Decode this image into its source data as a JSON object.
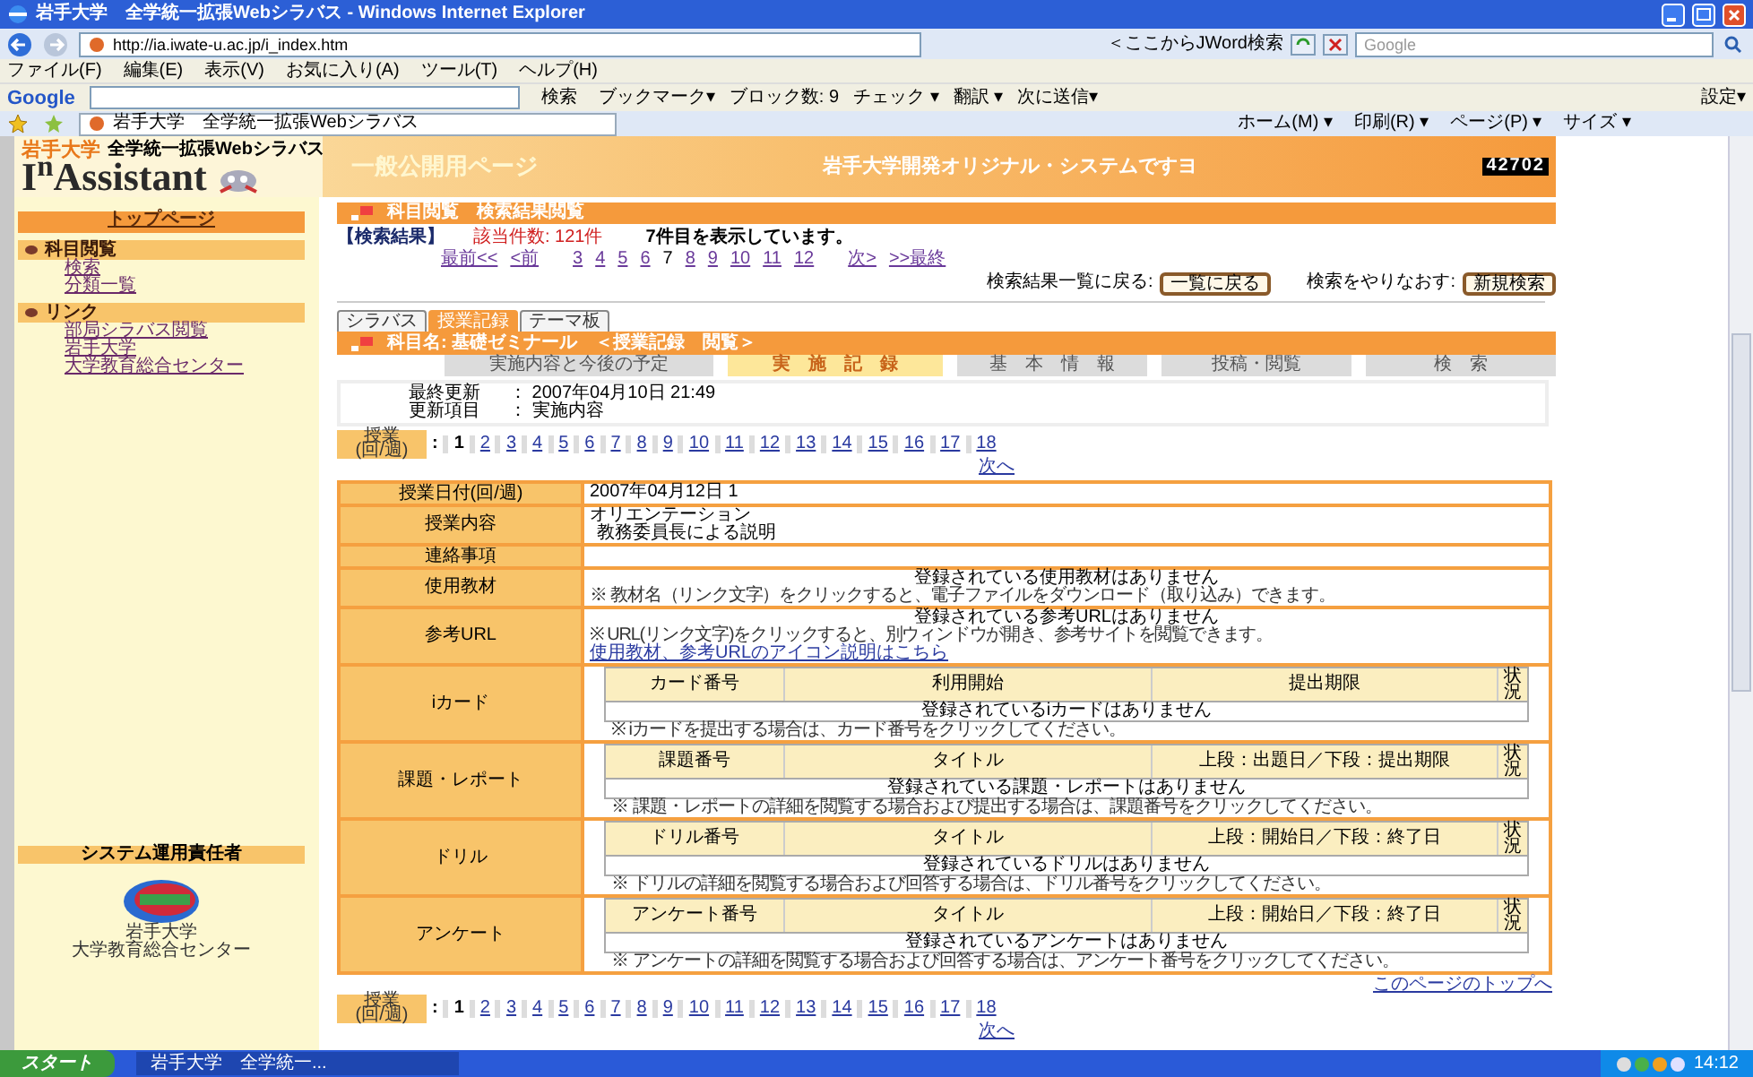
{
  "browser": {
    "title": "岩手大学　全学統一拡張Webシラバス - Windows Internet Explorer",
    "url": "http://ia.iwate-u.ac.jp/i_index.htm",
    "jword": "＜ここからJWord検索",
    "search_placeholder": "Google",
    "menu": [
      "ファイル(F)",
      "編集(E)",
      "表示(V)",
      "お気に入り(A)",
      "ツール(T)",
      "ヘルプ(H)"
    ],
    "google_logo": "Google",
    "google_search": "検索",
    "google_items": [
      "ブックマーク▾",
      "ブロック数: 9",
      "チェック ▾",
      "翻訳 ▾",
      "次に送信▾"
    ],
    "settings": "設定▾",
    "tab": "岩手大学　全学統一拡張Webシラバス",
    "commands": [
      "ホーム(M) ▾",
      "印刷(R) ▾",
      "ページ(P) ▾",
      "サイズ ▾"
    ]
  },
  "header": {
    "university": "岩手大学",
    "system": "全学統一拡張Webシラバス",
    "logo": "I$^{n}$Assistant",
    "page_label": "一般公開用ページ",
    "slogan": "岩手大学開発オリジナル・システムですヨ",
    "counter": "42702"
  },
  "sidebar": {
    "top_link": "トップページ",
    "sections": [
      {
        "title": "科目閲覧",
        "links": [
          "検索",
          "分類一覧"
        ]
      },
      {
        "title": "リンク",
        "links": [
          "部局シラバス閲覧",
          "岩手大学",
          "大学教育総合センター"
        ]
      }
    ],
    "admin": {
      "title": "システム運用責任者",
      "org": [
        "岩手大学",
        "大学教育総合センター"
      ]
    }
  },
  "content": {
    "title": "科目閲覧　検索結果閲覧",
    "result_label": "【検索結果】",
    "count": "該当件数: 121件",
    "showing": "7件目を表示しています。",
    "pager": [
      {
        "label": "最前<<",
        "selected": false
      },
      {
        "label": "<前",
        "selected": false
      },
      {
        "label": "3",
        "selected": false
      },
      {
        "label": "4",
        "selected": false
      },
      {
        "label": "5",
        "selected": false
      },
      {
        "label": "6",
        "selected": false
      },
      {
        "label": "7",
        "selected": true
      },
      {
        "label": "8",
        "selected": false
      },
      {
        "label": "9",
        "selected": false
      },
      {
        "label": "10",
        "selected": false
      },
      {
        "label": "11",
        "selected": false
      },
      {
        "label": "12",
        "selected": false
      },
      {
        "label": "次>",
        "selected": false
      },
      {
        "label": ">>最終",
        "selected": false
      }
    ],
    "back_label": "検索結果一覧に戻る:",
    "back_button": "一覧に戻る",
    "retry_label": "検索をやりなおす:",
    "new_button": "新規検索",
    "tabs": [
      {
        "label": "シラバス",
        "selected": false
      },
      {
        "label": "授業記録",
        "selected": true
      },
      {
        "label": "テーマ板",
        "selected": false
      }
    ],
    "subject": "科目名: 基礎ゼミナール　＜授業記録　閲覧＞",
    "subtabs": [
      {
        "label": "実施内容と今後の予定",
        "selected": false
      },
      {
        "label": "実　施　記　録",
        "selected": true
      },
      {
        "label": "基　本　情　報",
        "selected": false
      },
      {
        "label": "投稿・閲覧",
        "selected": false
      },
      {
        "label": "検　索",
        "selected": false
      }
    ],
    "info": [
      {
        "label": "最終更新",
        "value": "： 2007年04月10日 21:49"
      },
      {
        "label": "更新項目",
        "value": "： 実施内容"
      }
    ],
    "session_nav_top": {
      "label": [
        "授業",
        "(回/週)"
      ],
      "separator": ":",
      "pages": [
        {
          "label": "1",
          "selected": true
        },
        {
          "label": "2",
          "selected": false
        },
        {
          "label": "3",
          "selected": false
        },
        {
          "label": "4",
          "selected": false
        },
        {
          "label": "5",
          "selected": false
        },
        {
          "label": "6",
          "selected": false
        },
        {
          "label": "7",
          "selected": false
        },
        {
          "label": "8",
          "selected": false
        },
        {
          "label": "9",
          "selected": false
        },
        {
          "label": "10",
          "selected": false
        },
        {
          "label": "11",
          "selected": false
        },
        {
          "label": "12",
          "selected": false
        },
        {
          "label": "13",
          "selected": false
        },
        {
          "label": "14",
          "selected": false
        },
        {
          "label": "15",
          "selected": false
        },
        {
          "label": "16",
          "selected": false
        },
        {
          "label": "17",
          "selected": false
        },
        {
          "label": "18",
          "selected": false
        }
      ],
      "next": "次へ"
    },
    "record": [
      {
        "kind": "text",
        "label": "授業日付(回/週)",
        "lines": [
          "2007年04月12日 1"
        ]
      },
      {
        "kind": "text",
        "label": "授業内容",
        "lines": [
          "オリエンテーション",
          "教務委員長による説明"
        ]
      },
      {
        "kind": "text",
        "label": "連絡事項"
      },
      {
        "kind": "notice",
        "label": "使用教材",
        "message": "登録されている使用教材はありません",
        "note": "※ 教材名（リンク文字）をクリックすると、電子ファイルをダウンロード（取り込み）できます。"
      },
      {
        "kind": "notice",
        "label": "参考URL",
        "message": "登録されている参考URLはありません",
        "note": "※ URL(リンク文字)をクリックすると、別ウィンドウが開き、参考サイトを閲覧できます。",
        "link": "使用教材、参考URLのアイコン説明はこちら"
      },
      {
        "kind": "list",
        "label": "iカード",
        "columns": [
          "カード番号",
          "利用開始",
          "提出期限",
          "状況"
        ],
        "empty": "登録されているiカードはありません",
        "note": "※ iカードを提出する場合は、カード番号をクリックしてください。"
      },
      {
        "kind": "list",
        "label": "課題・レポート",
        "columns": [
          "課題番号",
          "タイトル",
          "上段：出題日／下段：提出期限",
          "状況"
        ],
        "empty": "登録されている課題・レポートはありません",
        "note": "※ 課題・レポートの詳細を閲覧する場合および提出する場合は、課題番号をクリックしてください。"
      },
      {
        "kind": "list",
        "label": "ドリル",
        "columns": [
          "ドリル番号",
          "タイトル",
          "上段：開始日／下段：終了日",
          "状況"
        ],
        "empty": "登録されているドリルはありません",
        "note": "※ ドリルの詳細を閲覧する場合および回答する場合は、ドリル番号をクリックしてください。"
      },
      {
        "kind": "list",
        "label": "アンケート",
        "columns": [
          "アンケート番号",
          "タイトル",
          "上段：開始日／下段：終了日",
          "状況"
        ],
        "empty": "登録されているアンケートはありません",
        "note": "※ アンケートの詳細を閲覧する場合および回答する場合は、アンケート番号をクリックしてください。"
      }
    ],
    "page_top_link": "このページのトップへ",
    "session_nav_bottom": {
      "label": [
        "授業",
        "(回/週)"
      ],
      "separator": ":",
      "pages": [
        {
          "label": "1",
          "selected": true
        },
        {
          "label": "2",
          "selected": false
        },
        {
          "label": "3",
          "selected": false
        },
        {
          "label": "4",
          "selected": false
        },
        {
          "label": "5",
          "selected": false
        },
        {
          "label": "6",
          "selected": false
        },
        {
          "label": "7",
          "selected": false
        },
        {
          "label": "8",
          "selected": false
        },
        {
          "label": "9",
          "selected": false
        },
        {
          "label": "10",
          "selected": false
        },
        {
          "label": "11",
          "selected": false
        },
        {
          "label": "12",
          "selected": false
        },
        {
          "label": "13",
          "selected": false
        },
        {
          "label": "14",
          "selected": false
        },
        {
          "label": "15",
          "selected": false
        },
        {
          "label": "16",
          "selected": false
        },
        {
          "label": "17",
          "selected": false
        },
        {
          "label": "18",
          "selected": false
        }
      ],
      "next": "次へ"
    }
  },
  "taskbar": {
    "start": "スタート",
    "task": "岩手大学　全学統一...",
    "clock": "14:12"
  }
}
